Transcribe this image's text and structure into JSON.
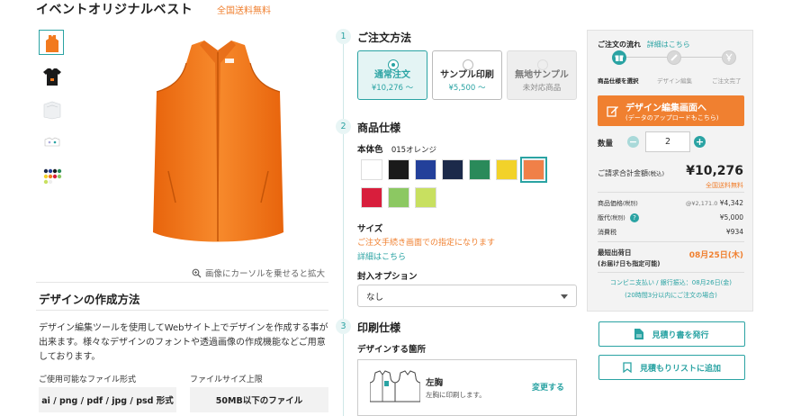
{
  "product": {
    "title": "イベントオリジナルベスト",
    "free_shipping": "全国送料無料"
  },
  "gallery": {
    "zoom_hint": "画像にカーソルを乗せると拡大"
  },
  "design_method": {
    "title": "デザインの作成方法",
    "description": "デザイン編集ツールを使用してWebサイト上でデザインを作成する事が出来ます。様々なデザインのフォントや透過画像の作成機能などご用意しております。",
    "formats_label": "ご使用可能なファイル形式",
    "formats_value": "ai / png / pdf / jpg / psd 形式",
    "size_label": "ファイルサイズ上限",
    "size_value": "50MB以下のファイル"
  },
  "steps": [
    {
      "num": "1",
      "title": "ご注文方法"
    },
    {
      "num": "2",
      "title": "商品仕様"
    },
    {
      "num": "3",
      "title": "印刷仕様"
    }
  ],
  "order_methods": [
    {
      "name": "通常注文",
      "price": "¥10,276 〜",
      "state": "selected"
    },
    {
      "name": "サンプル印刷",
      "price": "¥5,500 〜",
      "state": "normal"
    },
    {
      "name": "無地サンプル",
      "price": "未対応商品",
      "state": "disabled"
    }
  ],
  "spec": {
    "color_label": "本体色",
    "color_value": "015オレンジ",
    "colors": [
      "#ffffff",
      "#1a1a1a",
      "#23409a",
      "#1c2a4a",
      "#2a8a5a",
      "#f2d22a",
      "#f08048",
      "#d81e3c",
      "#8cc862",
      "#c8e060"
    ],
    "size_label": "サイズ",
    "size_note": "ご注文手続き画面での指定になります",
    "detail_link": "詳細はこちら",
    "packing_label": "封入オプション",
    "packing_value": "なし"
  },
  "print": {
    "location_label": "デザインする箇所",
    "location_name": "左胸",
    "location_desc": "左胸に印刷します。",
    "change_link": "変更する"
  },
  "summary": {
    "flow_title": "ご注文の流れ",
    "flow_link": "詳細はこちら",
    "flow_steps": [
      "商品仕様を選択",
      "デザイン編集",
      "ご注文完了"
    ],
    "design_btn_main": "デザイン編集画面へ",
    "design_btn_sub": "(データのアップロードもこちら)",
    "qty_label": "数量",
    "qty_value": "2",
    "total_label": "ご請求合計金額",
    "total_tax": "(税込)",
    "total_value": "¥10,276",
    "total_shipping": "全国送料無料",
    "price_label": "商品価格",
    "price_tax": "(税別)",
    "price_unit": "@¥2,171.0",
    "price_value": "¥4,342",
    "plate_label": "版代",
    "plate_tax": "(税別)",
    "plate_value": "¥5,000",
    "consumption_label": "消費税",
    "consumption_value": "¥934",
    "ship_label": "最短出荷日",
    "ship_sub": "(お届け日も指定可能)",
    "ship_value": "08月25日(木)",
    "conv_note": "コンビニ支払い / 銀行振込：08月26日(金)",
    "conv_sub": "(20時間3分以内にご注文の場合)"
  },
  "actions": {
    "estimate": "見積り書を発行",
    "add_list": "見積もりリストに追加"
  },
  "colors": {
    "accent": "#2aa3a3",
    "orange": "#f08030"
  }
}
